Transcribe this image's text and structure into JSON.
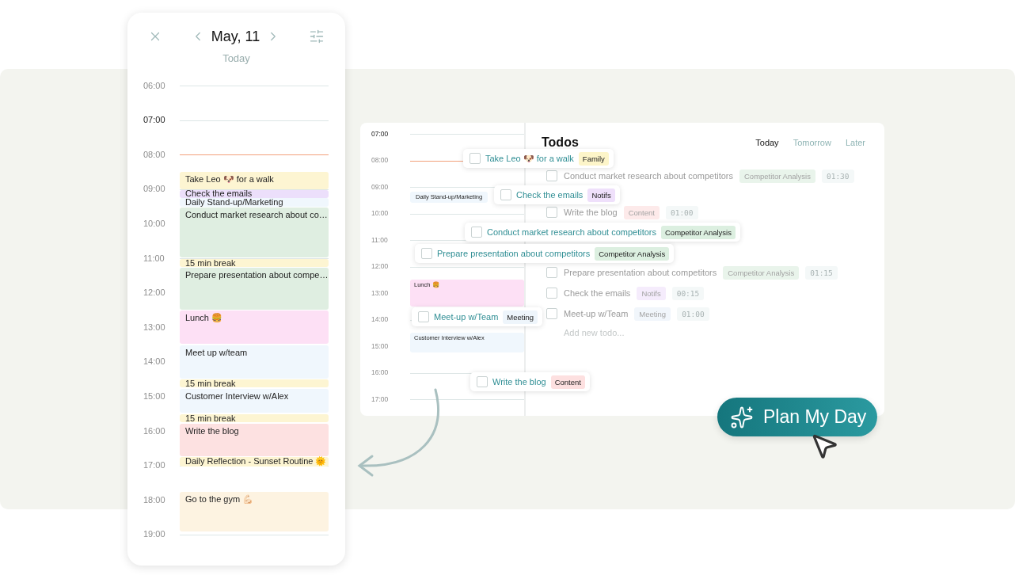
{
  "phone": {
    "date": "May, 11",
    "subtitle": "Today",
    "hours": [
      {
        "label": "06:00",
        "highlighted": false,
        "current": false
      },
      {
        "label": "07:00",
        "highlighted": true,
        "current": false
      },
      {
        "label": "08:00",
        "highlighted": false,
        "current": true
      },
      {
        "label": "09:00",
        "highlighted": false,
        "current": false
      },
      {
        "label": "10:00",
        "highlighted": false,
        "current": false
      },
      {
        "label": "11:00",
        "highlighted": false,
        "current": false
      },
      {
        "label": "12:00",
        "highlighted": false,
        "current": false
      },
      {
        "label": "13:00",
        "highlighted": false,
        "current": false
      },
      {
        "label": "14:00",
        "highlighted": false,
        "current": false
      },
      {
        "label": "15:00",
        "highlighted": false,
        "current": false
      },
      {
        "label": "16:00",
        "highlighted": false,
        "current": false
      },
      {
        "label": "17:00",
        "highlighted": false,
        "current": false
      },
      {
        "label": "18:00",
        "highlighted": false,
        "current": false
      },
      {
        "label": "19:00",
        "highlighted": false,
        "current": false
      }
    ],
    "events": [
      {
        "title": "Take Leo 🐶 for a walk",
        "color": "#fdf5d2"
      },
      {
        "title": "Check the emails",
        "color": "#ecdffb"
      },
      {
        "title": "Daily Stand-up/Marketing",
        "color": "#f0f7fd"
      },
      {
        "title": "Conduct market research about co…",
        "color": "#dfeee1"
      },
      {
        "title": "15 min break",
        "color": "#fdf5d2"
      },
      {
        "title": "Prepare presentation about compe…",
        "color": "#dfeee1"
      },
      {
        "title": "Lunch 🍔",
        "color": "#fde0f5"
      },
      {
        "title": "Meet up w/team",
        "color": "#f0f7fd"
      },
      {
        "title": "15 min break",
        "color": "#fdf5d2"
      },
      {
        "title": "Customer Interview w/Alex",
        "color": "#f0f7fd"
      },
      {
        "title": "15 min break",
        "color": "#fdf5d2"
      },
      {
        "title": "Write the blog",
        "color": "#fde1e1"
      },
      {
        "title": "Daily Reflection - Sunset Routine 🌞",
        "color": "#fdf5d2"
      },
      {
        "title": "Go to the gym 💪🏻",
        "color": "#fdf3e1"
      }
    ]
  },
  "planner": {
    "hours": [
      {
        "label": "07:00",
        "highlighted": true,
        "current": false
      },
      {
        "label": "08:00",
        "highlighted": false,
        "current": true
      },
      {
        "label": "09:00",
        "highlighted": false,
        "current": false
      },
      {
        "label": "10:00",
        "highlighted": false,
        "current": false
      },
      {
        "label": "11:00",
        "highlighted": false,
        "current": false
      },
      {
        "label": "12:00",
        "highlighted": false,
        "current": false
      },
      {
        "label": "13:00",
        "highlighted": false,
        "current": false
      },
      {
        "label": "14:00",
        "highlighted": false,
        "current": false
      },
      {
        "label": "15:00",
        "highlighted": false,
        "current": false
      },
      {
        "label": "16:00",
        "highlighted": false,
        "current": false
      },
      {
        "label": "17:00",
        "highlighted": false,
        "current": false
      }
    ],
    "events": [
      {
        "title": "Daily Stand-up/Marketing",
        "color": "#f0f7fd"
      },
      {
        "title": "Lunch 🍔",
        "color": "#fde0f5"
      },
      {
        "title": "Customer Interview w/Alex",
        "color": "#f0f7fd"
      }
    ],
    "todos": {
      "title": "Todos",
      "tabs": [
        {
          "label": "Today",
          "selected": true
        },
        {
          "label": "Tomorrow",
          "selected": false
        },
        {
          "label": "Later",
          "selected": false
        }
      ],
      "rows": [
        {
          "title": "Conduct market research about competitors",
          "tag": "Competitor Analysis",
          "color": "#e9f4eb",
          "duration": "01:30",
          "checked": false
        },
        {
          "title": "Write the blog",
          "tag": "Content",
          "color": "#fdeaea",
          "duration": "01:00",
          "checked": false
        },
        {
          "title": "Prepare presentation about competitors",
          "tag": "Competitor Analysis",
          "color": "#e9f4eb",
          "duration": "01:15",
          "checked": false
        },
        {
          "title": "Check the emails",
          "tag": "Notifs",
          "color": "#f5ecfc",
          "duration": "00:15",
          "checked": false
        },
        {
          "title": "Meet-up w/Team",
          "tag": "Meeting",
          "color": "#f1f6fb",
          "duration": "01:00",
          "checked": false
        }
      ],
      "placeholder": "Add new todo..."
    }
  },
  "dragged_todos": [
    {
      "title": "Take Leo 🐶 for a walk",
      "tag": "Family",
      "color": "#fdf5c9",
      "checked": false
    },
    {
      "title": "Check the emails",
      "tag": "Notifs",
      "color": "#efe0fb",
      "checked": false
    },
    {
      "title": "Conduct market research about competitors",
      "tag": "Competitor Analysis",
      "color": "#dcefe0",
      "checked": false
    },
    {
      "title": "Prepare presentation about competitors",
      "tag": "Competitor Analysis",
      "color": "#dcefe0",
      "checked": false
    },
    {
      "title": "Meet-up w/Team",
      "tag": "Meeting",
      "color": "#eef5fb",
      "checked": false
    },
    {
      "title": "Write the blog",
      "tag": "Content",
      "color": "#fde0e0",
      "checked": false
    }
  ],
  "button": {
    "label": "Plan My Day"
  }
}
